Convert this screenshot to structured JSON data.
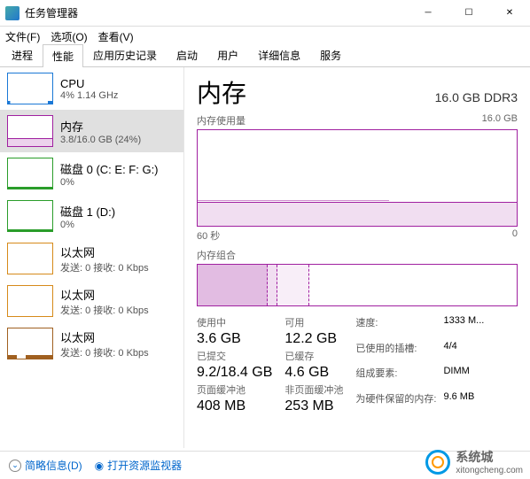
{
  "window": {
    "title": "任务管理器"
  },
  "menu": {
    "file": "文件(F)",
    "options": "选项(O)",
    "view": "查看(V)"
  },
  "tabs": [
    "进程",
    "性能",
    "应用历史记录",
    "启动",
    "用户",
    "详细信息",
    "服务"
  ],
  "sidebar": [
    {
      "name": "CPU",
      "stat": "4% 1.14 GHz",
      "cls": "cpu"
    },
    {
      "name": "内存",
      "stat": "3.8/16.0 GB (24%)",
      "cls": "mem"
    },
    {
      "name": "磁盘 0 (C: E: F: G:)",
      "stat": "0%",
      "cls": "disk"
    },
    {
      "name": "磁盘 1 (D:)",
      "stat": "0%",
      "cls": "disk"
    },
    {
      "name": "以太网",
      "stat": "发送: 0 接收: 0 Kbps",
      "cls": "eth0"
    },
    {
      "name": "以太网",
      "stat": "发送: 0 接收: 0 Kbps",
      "cls": "eth1"
    },
    {
      "name": "以太网",
      "stat": "发送: 0 接收: 0 Kbps",
      "cls": "eth2"
    }
  ],
  "main": {
    "title": "内存",
    "subtitle": "16.0 GB DDR3",
    "usage_label": "内存使用量",
    "usage_max": "16.0 GB",
    "axis_left": "60 秒",
    "axis_right": "0",
    "comp_label": "内存组合",
    "stats": {
      "in_use_lbl": "使用中",
      "in_use": "3.6 GB",
      "avail_lbl": "可用",
      "avail": "12.2 GB",
      "commit_lbl": "已提交",
      "commit": "9.2/18.4 GB",
      "cached_lbl": "已缓存",
      "cached": "4.6 GB",
      "paged_lbl": "页面缓冲池",
      "paged": "408 MB",
      "nonpaged_lbl": "非页面缓冲池",
      "nonpaged": "253 MB"
    },
    "kv": {
      "speed_l": "速度:",
      "speed_v": "1333 M...",
      "slots_l": "已使用的插槽:",
      "slots_v": "4/4",
      "form_l": "组成要素:",
      "form_v": "DIMM",
      "hw_l": "为硬件保留的内存:",
      "hw_v": "9.6 MB"
    }
  },
  "footer": {
    "brief": "简略信息(D)",
    "resmon": "打开资源监视器"
  },
  "watermark": "系统城",
  "watermark_url": "xitongcheng.com",
  "chart_data": {
    "type": "area",
    "title": "内存使用量",
    "xlabel": "60 秒",
    "ylabel": "GB",
    "ylim": [
      0,
      16.0
    ],
    "x": [
      60,
      55,
      50,
      45,
      40,
      35,
      30,
      25,
      20,
      15,
      10,
      5,
      0
    ],
    "series": [
      {
        "name": "使用中",
        "values": [
          3.7,
          3.7,
          3.7,
          3.7,
          3.7,
          3.7,
          3.7,
          3.7,
          3.8,
          3.8,
          3.8,
          3.8,
          3.8
        ]
      }
    ]
  }
}
